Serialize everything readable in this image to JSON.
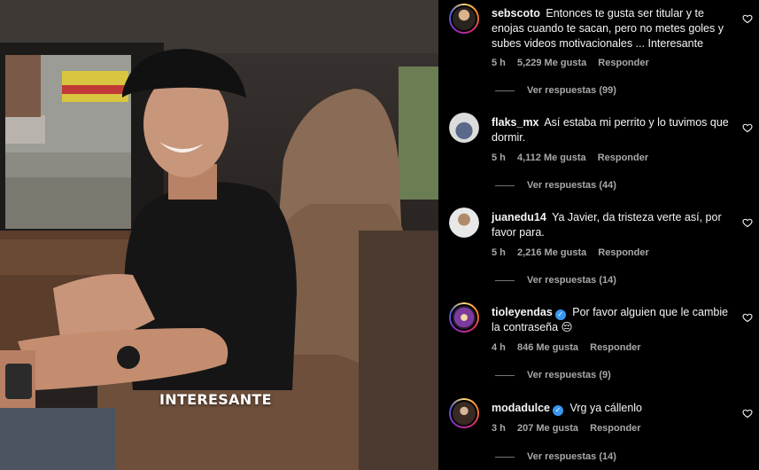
{
  "media": {
    "caption": "INTERESANTE"
  },
  "comments": [
    {
      "username": "sebscoto",
      "verified": false,
      "text": "Entonces te gusta ser titular y te enojas cuando te sacan, pero no metes goles y subes videos motivacionales ... Interesante",
      "time": "5 h",
      "likes": "5,229 Me gusta",
      "reply_label": "Responder",
      "view_replies": "Ver respuestas (99)",
      "avatar_icon": "avatar-sebscoto"
    },
    {
      "username": "flaks_mx",
      "verified": false,
      "text": "Así estaba mi perrito y lo tuvimos que dormir.",
      "time": "5 h",
      "likes": "4,112 Me gusta",
      "reply_label": "Responder",
      "view_replies": "Ver respuestas (44)",
      "avatar_icon": "avatar-flaks-mx"
    },
    {
      "username": "juanedu14",
      "verified": false,
      "text": "Ya Javier, da tristeza verte así, por favor para.",
      "time": "5 h",
      "likes": "2,216 Me gusta",
      "reply_label": "Responder",
      "view_replies": "Ver respuestas (14)",
      "avatar_icon": "avatar-juanedu14"
    },
    {
      "username": "tioleyendas",
      "verified": true,
      "text": "Por favor alguien que le cambie la contraseña 😔",
      "time": "4 h",
      "likes": "846 Me gusta",
      "reply_label": "Responder",
      "view_replies": "Ver respuestas (9)",
      "avatar_icon": "avatar-tioleyendas"
    },
    {
      "username": "modadulce",
      "verified": true,
      "text": "Vrg ya cállenlo",
      "time": "3 h",
      "likes": "207 Me gusta",
      "reply_label": "Responder",
      "view_replies": "Ver respuestas (14)",
      "avatar_icon": "avatar-modadulce"
    }
  ],
  "icons": {
    "like": "heart-outline-icon",
    "verified": "verified-badge-icon"
  },
  "colors": {
    "background": "#000000",
    "text": "#f5f5f5",
    "secondary_text": "#a8a8a8",
    "verified": "#3897f0"
  }
}
